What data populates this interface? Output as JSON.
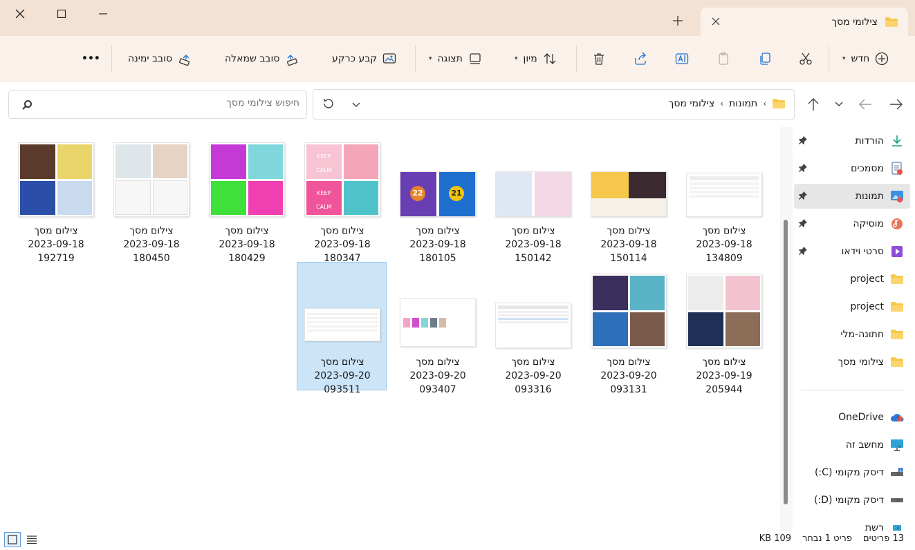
{
  "window": {
    "tab_title": "צילומי מסך"
  },
  "toolbar": {
    "new_label": "חדש",
    "sort_label": "מיון",
    "view_label": "תצוגה",
    "set_background_label": "קבע כרקע",
    "rotate_left_label": "סובב שמאלה",
    "rotate_right_label": "סובב ימינה",
    "more_label": "•••"
  },
  "address": {
    "crumbs": [
      "תמונות",
      "צילומי מסך"
    ],
    "search_placeholder": "חיפוש צילומי מסך"
  },
  "sidebar": {
    "quick": [
      {
        "label": "הורדות",
        "icon": "download-icon"
      },
      {
        "label": "מסמכים",
        "icon": "documents-icon"
      },
      {
        "label": "תמונות",
        "icon": "pictures-icon"
      },
      {
        "label": "מוסיקה",
        "icon": "music-icon"
      },
      {
        "label": "סרטי וידאו",
        "icon": "video-icon"
      },
      {
        "label": "project",
        "icon": "folder-icon"
      },
      {
        "label": "project",
        "icon": "folder-icon"
      },
      {
        "label": "חתונה-מלי",
        "icon": "folder-icon"
      },
      {
        "label": "צילומי מסך",
        "icon": "folder-icon"
      }
    ],
    "onedrive": "OneDrive",
    "this_pc": "מחשב זה",
    "drive_c": "דיסק מקומי (C:)",
    "drive_d": "דיסק מקומי (D:)",
    "network": "רשת"
  },
  "files": [
    {
      "l1": "צילום מסך",
      "l2": "2023-09-18",
      "l3": "134809"
    },
    {
      "l1": "צילום מסך",
      "l2": "2023-09-18",
      "l3": "150114"
    },
    {
      "l1": "צילום מסך",
      "l2": "2023-09-18",
      "l3": "150142"
    },
    {
      "l1": "צילום מסך",
      "l2": "2023-09-18",
      "l3": "180105"
    },
    {
      "l1": "צילום מסך",
      "l2": "2023-09-18",
      "l3": "180347"
    },
    {
      "l1": "צילום מסך",
      "l2": "2023-09-18",
      "l3": "180429"
    },
    {
      "l1": "צילום מסך",
      "l2": "2023-09-18",
      "l3": "180450"
    },
    {
      "l1": "צילום מסך",
      "l2": "2023-09-18",
      "l3": "192719"
    },
    {
      "l1": "צילום מסך",
      "l2": "2023-09-19",
      "l3": "205944"
    },
    {
      "l1": "צילום מסך",
      "l2": "2023-09-20",
      "l3": "093131"
    },
    {
      "l1": "צילום מסך",
      "l2": "2023-09-20",
      "l3": "093316"
    },
    {
      "l1": "צילום מסך",
      "l2": "2023-09-20",
      "l3": "093407"
    },
    {
      "l1": "צילום מסך",
      "l2": "2023-09-20",
      "l3": "093511"
    }
  ],
  "thumb_text": {
    "keep1": "KEEP",
    "calm1": "CALM",
    "keep2": "KEEP",
    "calm2": "CALM",
    "n22": "22",
    "n21": "21"
  },
  "status": {
    "count": "13 פריטים",
    "selected": "פריט 1 נבחר",
    "size": "109 KB"
  }
}
